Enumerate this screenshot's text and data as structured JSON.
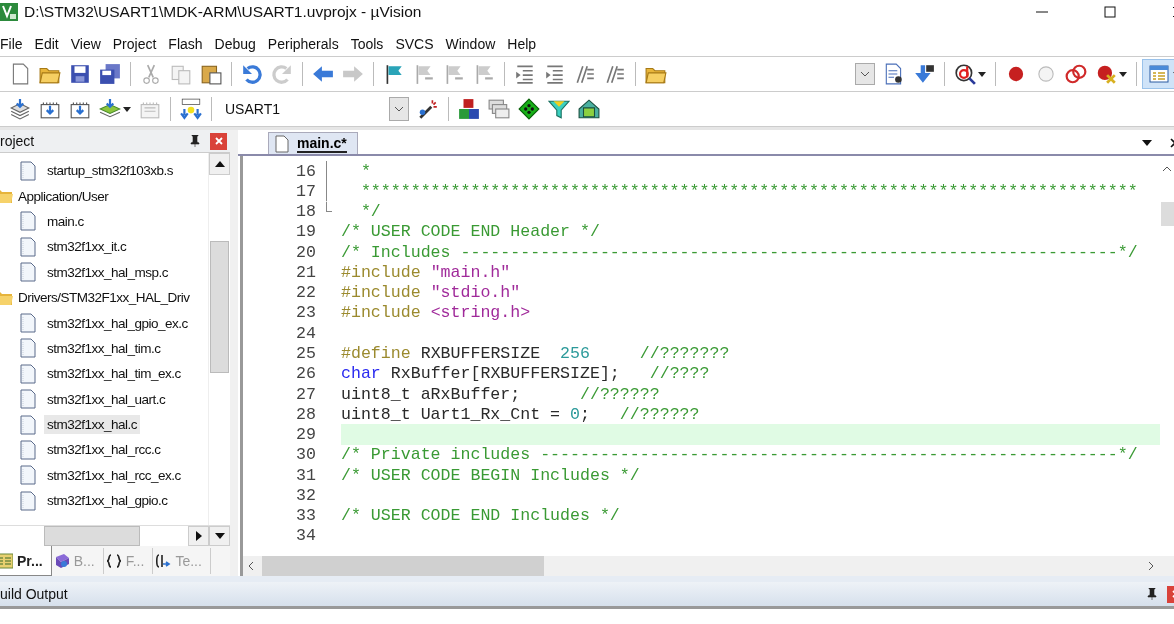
{
  "window": {
    "title": "D:\\STM32\\USART1\\MDK-ARM\\USART1.uvprojx - µVision"
  },
  "menu": [
    "File",
    "Edit",
    "View",
    "Project",
    "Flash",
    "Debug",
    "Peripherals",
    "Tools",
    "SVCS",
    "Window",
    "Help"
  ],
  "toolbar": {
    "target": "USART1"
  },
  "project_panel": {
    "title": "roject",
    "tree": [
      {
        "label": "startup_stm32f103xb.s",
        "kind": "file",
        "selected": false
      },
      {
        "label": "Application/User",
        "kind": "folder",
        "selected": false,
        "children": [
          {
            "label": "main.c",
            "kind": "file",
            "selected": false
          },
          {
            "label": "stm32f1xx_it.c",
            "kind": "file",
            "selected": false
          },
          {
            "label": "stm32f1xx_hal_msp.c",
            "kind": "file",
            "selected": false
          }
        ]
      },
      {
        "label": "Drivers/STM32F1xx_HAL_Driv",
        "kind": "folder",
        "selected": false,
        "children": [
          {
            "label": "stm32f1xx_hal_gpio_ex.c",
            "kind": "file",
            "selected": false
          },
          {
            "label": "stm32f1xx_hal_tim.c",
            "kind": "file",
            "selected": false
          },
          {
            "label": "stm32f1xx_hal_tim_ex.c",
            "kind": "file",
            "selected": false
          },
          {
            "label": "stm32f1xx_hal_uart.c",
            "kind": "file",
            "selected": false
          },
          {
            "label": "stm32f1xx_hal.c",
            "kind": "file",
            "selected": true
          },
          {
            "label": "stm32f1xx_hal_rcc.c",
            "kind": "file",
            "selected": false
          },
          {
            "label": "stm32f1xx_hal_rcc_ex.c",
            "kind": "file",
            "selected": false
          },
          {
            "label": "stm32f1xx_hal_gpio.c",
            "kind": "file",
            "selected": false
          }
        ]
      }
    ],
    "tabs": [
      {
        "label": "Pr...",
        "kind": "project",
        "selected": true
      },
      {
        "label": "B...",
        "kind": "books",
        "selected": false
      },
      {
        "label": "F...",
        "kind": "functions",
        "selected": false
      },
      {
        "label": "Te...",
        "kind": "templates",
        "selected": false
      }
    ]
  },
  "editor": {
    "tabs": [
      {
        "label": "main.c*",
        "selected": true
      }
    ],
    "lines": [
      {
        "number": "16",
        "current": false,
        "tokens": [
          {
            "kind": "comment",
            "text": "  *"
          }
        ]
      },
      {
        "number": "17",
        "current": false,
        "tokens": [
          {
            "kind": "comment",
            "text": "  ******************************************************************************"
          }
        ]
      },
      {
        "number": "18",
        "current": false,
        "tokens": [
          {
            "kind": "comment",
            "text": "  */"
          }
        ]
      },
      {
        "number": "19",
        "current": false,
        "tokens": [
          {
            "kind": "comment",
            "text": "/* USER CODE END Header */"
          }
        ]
      },
      {
        "number": "20",
        "current": false,
        "tokens": [
          {
            "kind": "comment",
            "text": "/* Includes ------------------------------------------------------------------*/"
          }
        ]
      },
      {
        "number": "21",
        "current": false,
        "tokens": [
          {
            "kind": "preproc",
            "text": "#include "
          },
          {
            "kind": "string",
            "text": "\"main.h\""
          }
        ]
      },
      {
        "number": "22",
        "current": false,
        "tokens": [
          {
            "kind": "preproc",
            "text": "#include "
          },
          {
            "kind": "string",
            "text": "\"stdio.h\""
          }
        ]
      },
      {
        "number": "23",
        "current": false,
        "tokens": [
          {
            "kind": "preproc",
            "text": "#include "
          },
          {
            "kind": "string",
            "text": "<string.h>"
          }
        ]
      },
      {
        "number": "24",
        "current": false
      },
      {
        "number": "25",
        "current": false,
        "tokens": [
          {
            "kind": "preproc",
            "text": "#define"
          },
          {
            "kind": "plain",
            "text": " RXBUFFERSIZE  "
          },
          {
            "kind": "number",
            "text": "256"
          },
          {
            "kind": "comment",
            "text": "     //???????"
          }
        ]
      },
      {
        "number": "26",
        "current": false,
        "tokens": [
          {
            "kind": "keyword",
            "text": "char"
          },
          {
            "kind": "plain",
            "text": " RxBuffer[RXBUFFERSIZE];   "
          },
          {
            "kind": "comment",
            "text": "//????"
          }
        ]
      },
      {
        "number": "27",
        "current": false,
        "tokens": [
          {
            "kind": "plain",
            "text": "uint8_t aRxBuffer;      "
          },
          {
            "kind": "comment",
            "text": "//??????"
          }
        ]
      },
      {
        "number": "28",
        "current": false,
        "tokens": [
          {
            "kind": "plain",
            "text": "uint8_t Uart1_Rx_Cnt = "
          },
          {
            "kind": "number",
            "text": "0"
          },
          {
            "kind": "plain",
            "text": ";   "
          },
          {
            "kind": "comment",
            "text": "//??????"
          }
        ]
      },
      {
        "number": "29",
        "current": true
      },
      {
        "number": "30",
        "current": false,
        "tokens": [
          {
            "kind": "comment",
            "text": "/* Private includes ----------------------------------------------------------*/"
          }
        ]
      },
      {
        "number": "31",
        "current": false,
        "tokens": [
          {
            "kind": "comment",
            "text": "/* USER CODE BEGIN Includes */"
          }
        ]
      },
      {
        "number": "32",
        "current": false
      },
      {
        "number": "33",
        "current": false,
        "tokens": [
          {
            "kind": "comment",
            "text": "/* USER CODE END Includes */"
          }
        ]
      },
      {
        "number": "34",
        "current": false
      }
    ]
  },
  "build_output": {
    "title": "uild Output"
  }
}
